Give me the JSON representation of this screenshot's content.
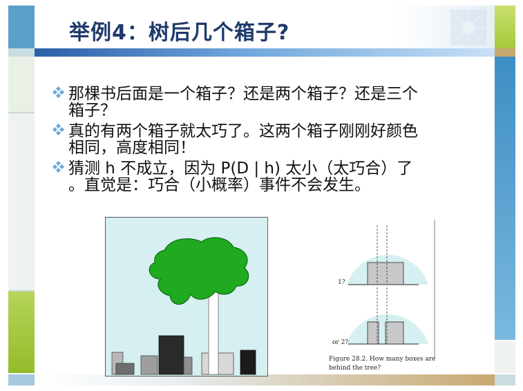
{
  "slide": {
    "title": "举例4：树后几个箱子?",
    "bullets": [
      {
        "line1": "那棵书后面是一个箱子？还是两个箱子？还是三个",
        "line2": "箱子？"
      },
      {
        "line1": "真的有两个箱子就太巧了。这两个箱子刚刚好颜色",
        "line2": "相同，高度相同！"
      },
      {
        "line1": "猜测 h 不成立，因为 P(D | h) 太小（太巧合）了",
        "line2": "。直觉是：巧合（小概率）事件不会发生。"
      }
    ]
  },
  "figure": {
    "label_one": "1?",
    "label_two": "or 2?",
    "caption_line1": "Figure 28.2.  How many boxes are",
    "caption_line2": "behind the tree?"
  },
  "colors": {
    "title_text": "#1f3a6b",
    "frame_blue": "#5aa0c8",
    "frame_green": "#a6c83a",
    "frame_tan": "#c8a870",
    "tree_green": "#1faa1f",
    "scene_sky": "#d6f0f2"
  },
  "icons": {
    "bullet": "diamond-bullet-icon",
    "decor": "sunburst-icon"
  }
}
